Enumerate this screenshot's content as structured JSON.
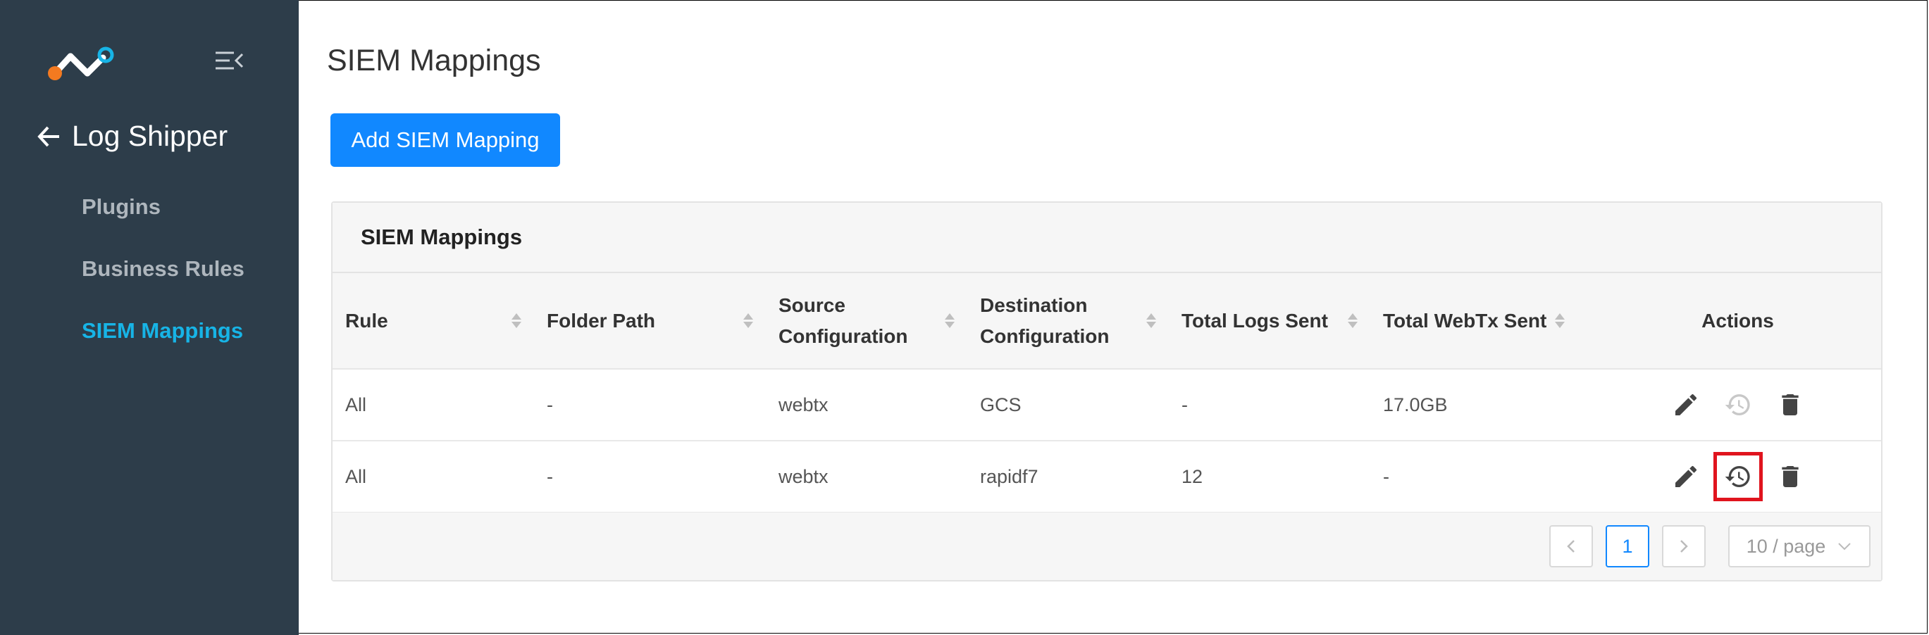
{
  "sidebar": {
    "back_label": "Log Shipper",
    "items": [
      {
        "label": "Plugins",
        "active": false
      },
      {
        "label": "Business Rules",
        "active": false
      },
      {
        "label": "SIEM Mappings",
        "active": true
      }
    ]
  },
  "main": {
    "title": "SIEM Mappings",
    "add_button": "Add SIEM Mapping",
    "card_title": "SIEM Mappings",
    "columns": [
      {
        "line1": "Rule",
        "line2": ""
      },
      {
        "line1": "Folder Path",
        "line2": ""
      },
      {
        "line1": "Source",
        "line2": "Configuration"
      },
      {
        "line1": "Destination",
        "line2": "Configuration"
      },
      {
        "line1": "Total Logs Sent",
        "line2": ""
      },
      {
        "line1": "Total WebTx Sent",
        "line2": ""
      },
      {
        "line1": "Actions",
        "line2": ""
      }
    ],
    "rows": [
      {
        "rule": "All",
        "folder": "-",
        "source": "webtx",
        "destination": "GCS",
        "logs": "-",
        "webtx": "17.0GB",
        "history_enabled": false
      },
      {
        "rule": "All",
        "folder": "-",
        "source": "webtx",
        "destination": "rapidf7",
        "logs": "12",
        "webtx": "-",
        "history_enabled": true
      }
    ],
    "pagination": {
      "current_page": "1",
      "page_size": "10 / page"
    }
  },
  "icons": [
    "collapse-menu-icon",
    "back-arrow-icon",
    "edit-icon",
    "history-icon",
    "delete-icon",
    "chevron-left-icon",
    "chevron-right-icon",
    "chevron-down-icon"
  ],
  "colors": {
    "sidebar_bg": "#2d3d4a",
    "accent": "#1188ff",
    "active_nav": "#17b4e6",
    "highlight": "#e0141e"
  }
}
